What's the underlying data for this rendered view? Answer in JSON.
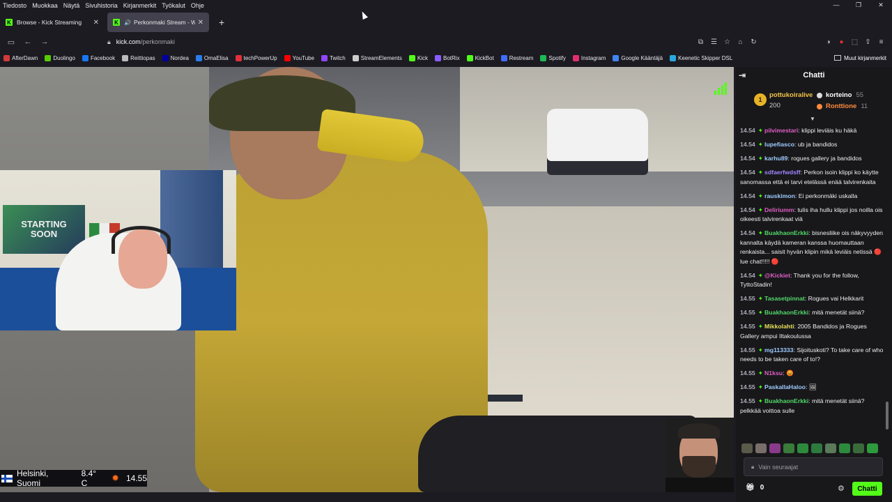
{
  "menubar": {
    "items": [
      "Tiedosto",
      "Muokkaa",
      "Näytä",
      "Sivuhistoria",
      "Kirjanmerkit",
      "Työkalut",
      "Ohje"
    ]
  },
  "tabs": [
    {
      "label": "Browse - Kick Streaming",
      "favicon": "K"
    },
    {
      "label": "Perkonmaki Stream - Watch",
      "favicon": "K"
    }
  ],
  "url": {
    "host": "kick.com",
    "path": "/perkonmaki"
  },
  "bookmarks": [
    {
      "label": "AfterDawn",
      "color": "#d23b3b"
    },
    {
      "label": "Duolingo",
      "color": "#58cc02"
    },
    {
      "label": "Facebook",
      "color": "#1877f2"
    },
    {
      "label": "Reittiopas",
      "color": "#bbbbbb"
    },
    {
      "label": "Nordea",
      "color": "#0000a0"
    },
    {
      "label": "OmaElisa",
      "color": "#2b7de9"
    },
    {
      "label": "techPowerUp",
      "color": "#e0303a"
    },
    {
      "label": "YouTube",
      "color": "#ff0000"
    },
    {
      "label": "Twitch",
      "color": "#9146ff"
    },
    {
      "label": "StreamElements",
      "color": "#cccccc"
    },
    {
      "label": "Kick",
      "color": "#53fc18"
    },
    {
      "label": "BotRix",
      "color": "#8a5cff"
    },
    {
      "label": "KickBot",
      "color": "#53fc18"
    },
    {
      "label": "Restream",
      "color": "#3f6dff"
    },
    {
      "label": "Spotify",
      "color": "#1db954"
    },
    {
      "label": "Instagram",
      "color": "#e1306c"
    },
    {
      "label": "Google Kääntäjä",
      "color": "#4285f4"
    },
    {
      "label": "Keenetic Skipper DSL",
      "color": "#28a7e0"
    }
  ],
  "bookmarks_other": "Muut kirjanmerkit",
  "video": {
    "pip_text_1": "STARTING",
    "pip_text_2": "SOON",
    "weather": {
      "city": "Helsinki, Suomi",
      "temp": "8.4° C",
      "time": "14.55"
    }
  },
  "chat": {
    "title": "Chatti",
    "leaderboard": {
      "first": {
        "rank": "1",
        "name": "pottukoiralive",
        "value": "200"
      },
      "second": {
        "name": "korteino",
        "value": "55"
      },
      "third": {
        "name": "Ronttione",
        "value": "11"
      }
    },
    "messages": [
      {
        "time": "14.54",
        "user": "pilvimestari",
        "color": "#e05fc4",
        "text": "klippi leviäis ku häkä"
      },
      {
        "time": "14.54",
        "user": "lupefiasco",
        "color": "#9ecbff",
        "text": "ub ja bandidos"
      },
      {
        "time": "14.54",
        "user": "karhu89",
        "color": "#9ecbff",
        "text": "rogues gallery ja bandidos"
      },
      {
        "time": "14.54",
        "user": "sdfaerfwdsff",
        "color": "#9f85ff",
        "text": "Perkon isoin klippi ko käytte sanomassa että ei tarvi etelässä enää talvirenkaita"
      },
      {
        "time": "14.54",
        "user": "rauskimon",
        "color": "#9ecbff",
        "text": "Ei perkonmäki uskalla"
      },
      {
        "time": "14.54",
        "user": "Deliriumm",
        "color": "#e05fc4",
        "text": "tulis iha hullu klippi jos noilla ois oikeesti talvirenkaat viä"
      },
      {
        "time": "14.54",
        "user": "BuakhaonErkki",
        "color": "#53d86a",
        "text": "bisnesliike ois näkyvyyden kannalta käydä kameran kanssa huomauttaan renkaista... saisit hyvän klipin mikä leviäis netissä 🔴 lue chat!!!!! 🔴"
      },
      {
        "time": "14.54",
        "user": "@Kickiet",
        "color": "#e05fc4",
        "text": "Thank you for the follow, TyttoStadin!"
      },
      {
        "time": "14.55",
        "user": "Tasasetpinnat",
        "color": "#53d86a",
        "text": "Rogues vai Helkkarit"
      },
      {
        "time": "14.55",
        "user": "BuakhaonErkki",
        "color": "#53d86a",
        "text": "mitä menetät siinä?"
      },
      {
        "time": "14.55",
        "user": "Mikkolahti",
        "color": "#e6e05a",
        "text": "2005 Bandidos ja Rogues Gallery ampui Iltakoulussa"
      },
      {
        "time": "14.55",
        "user": "mg113333",
        "color": "#9ecbff",
        "text": "Sijoituskoti? To take care of who needs to be taken care of to!?"
      },
      {
        "time": "14.55",
        "user": "N1ksu",
        "color": "#e05fc4",
        "text": "😡"
      },
      {
        "time": "14.55",
        "user": "PaskallaHaloo",
        "color": "#9ecbff",
        "text": "🖼"
      },
      {
        "time": "14.55",
        "user": "BuakhaonErkki",
        "color": "#53d86a",
        "text": "mitä menetät siinä? pelkkää voittoa sulle"
      }
    ],
    "input_placeholder": "Vain seuraajat",
    "points": "0",
    "send_label": "Chatti"
  }
}
